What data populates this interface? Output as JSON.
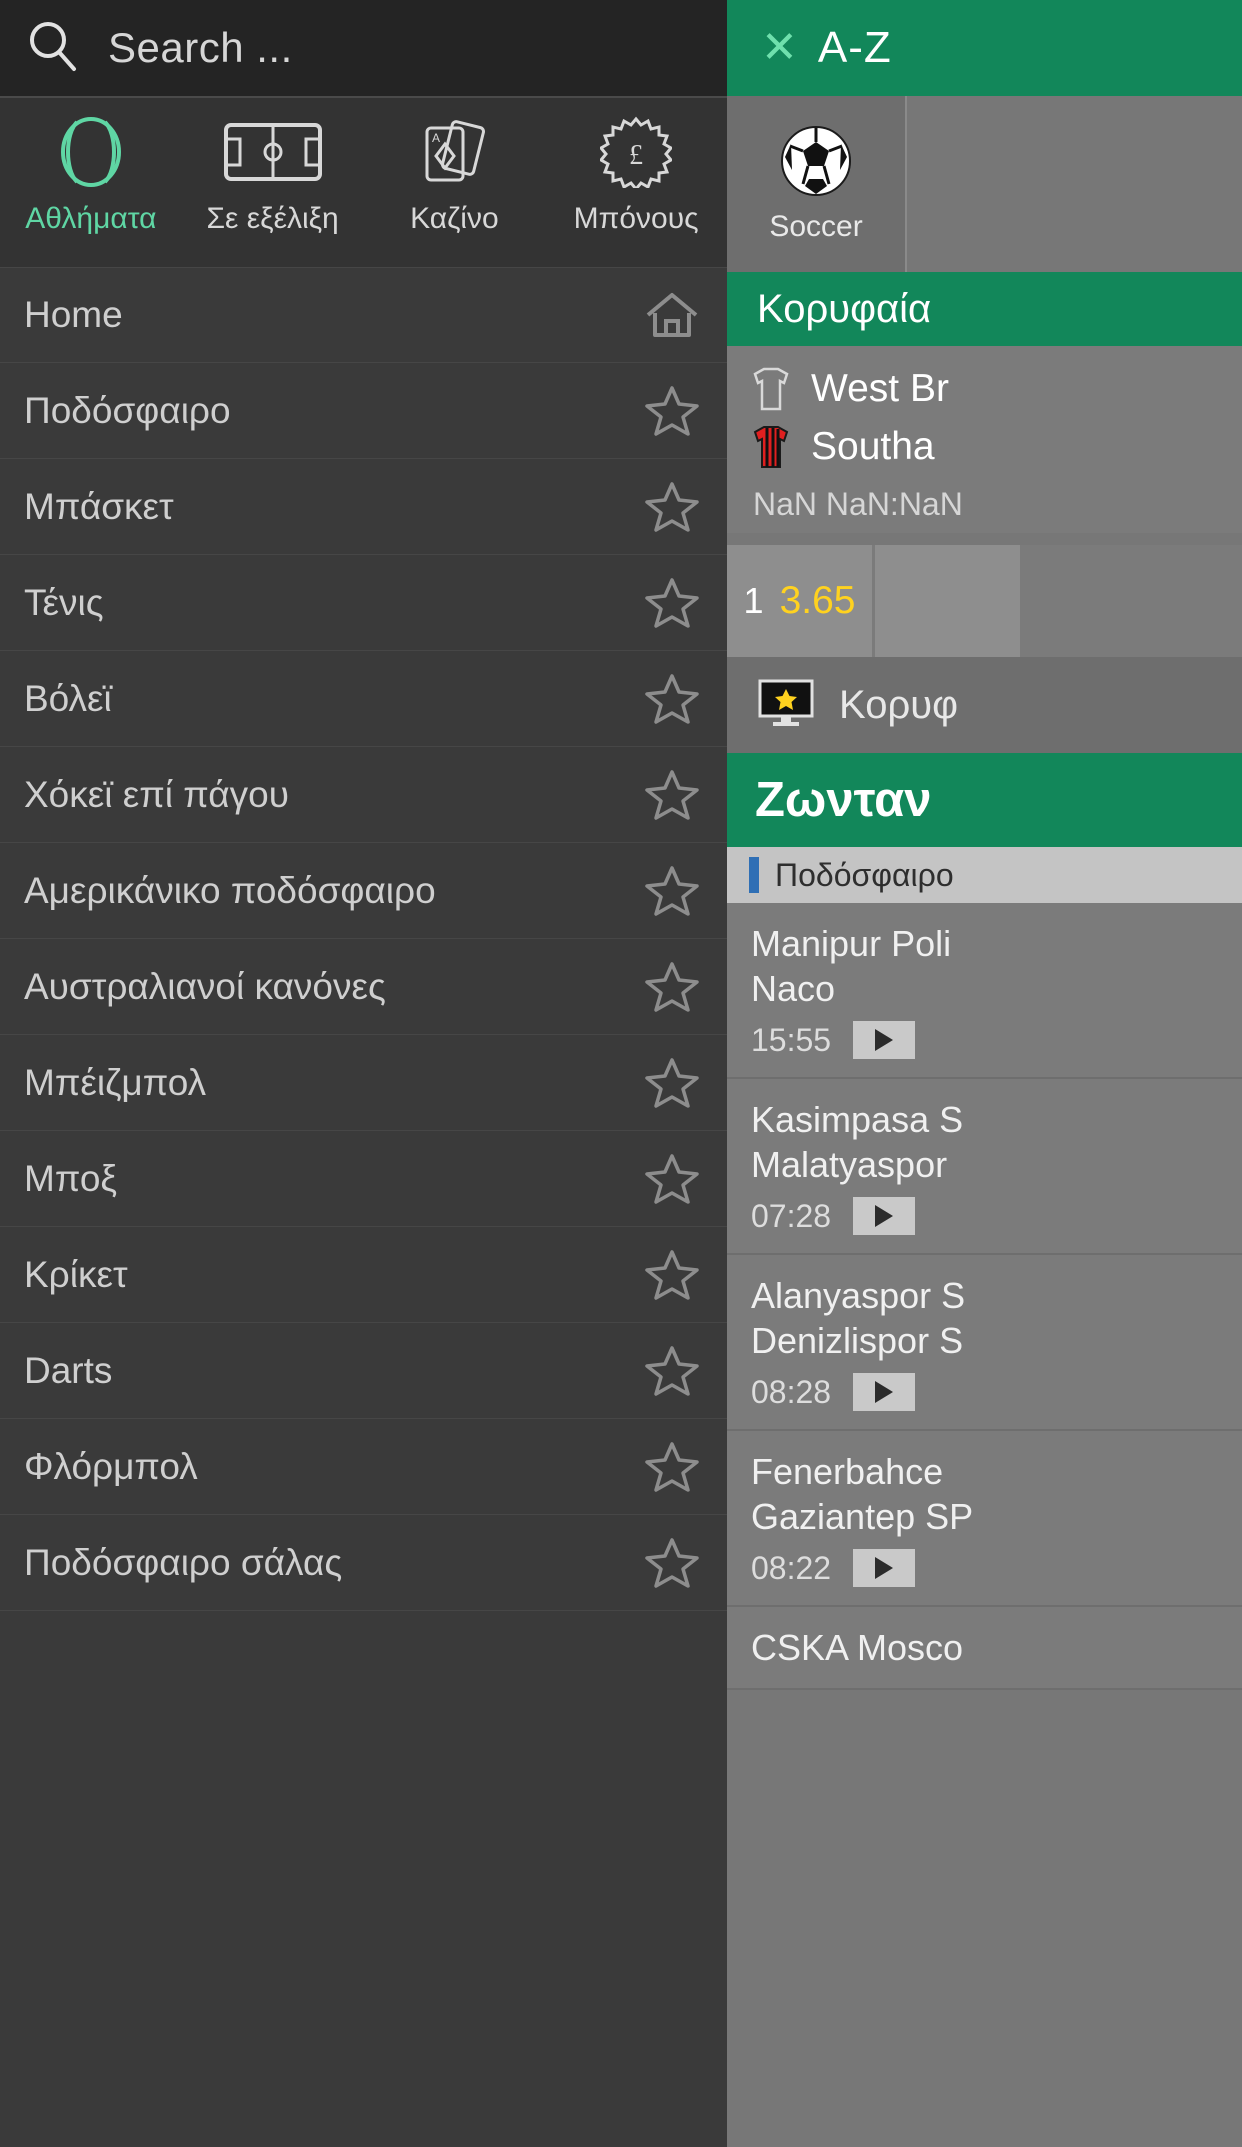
{
  "search": {
    "placeholder": "Search ...",
    "icon": "search-icon"
  },
  "tabs": [
    {
      "label": "Αθλήματα",
      "icon": "tennis-ball-icon",
      "active": true
    },
    {
      "label": "Σε εξέλιξη",
      "icon": "soccer-pitch-icon",
      "active": false
    },
    {
      "label": "Καζίνο",
      "icon": "playing-cards-icon",
      "active": false
    },
    {
      "label": "Μπόνους",
      "icon": "pound-badge-icon",
      "active": false
    }
  ],
  "sidebar": {
    "items": [
      {
        "label": "Home",
        "icon": "home-icon"
      },
      {
        "label": "Ποδόσφαιρο",
        "icon": "star-icon"
      },
      {
        "label": "Μπάσκετ",
        "icon": "star-icon"
      },
      {
        "label": "Τένις",
        "icon": "star-icon"
      },
      {
        "label": "Βόλεϊ",
        "icon": "star-icon"
      },
      {
        "label": "Χόκεϊ επί πάγου",
        "icon": "star-icon"
      },
      {
        "label": "Αμερικάνικο ποδόσφαιρο",
        "icon": "star-icon"
      },
      {
        "label": "Αυστραλιανοί κανόνες",
        "icon": "star-icon"
      },
      {
        "label": "Μπέιζμπολ",
        "icon": "star-icon"
      },
      {
        "label": "Μποξ",
        "icon": "star-icon"
      },
      {
        "label": "Κρίκετ",
        "icon": "star-icon"
      },
      {
        "label": "Darts",
        "icon": "star-icon"
      },
      {
        "label": "Φλόρμπολ",
        "icon": "star-icon"
      },
      {
        "label": "Ποδόσφαιρο σάλας",
        "icon": "star-icon"
      }
    ]
  },
  "right": {
    "az": {
      "close": "✕",
      "label": "A-Z"
    },
    "sport_chip": {
      "label": "Soccer",
      "icon": "soccer-ball-icon"
    },
    "top_header": "Κορυφαία ",
    "featured_match": {
      "home": "West Br",
      "away": "Southa",
      "time": "NaN NaN:NaN",
      "odds": [
        {
          "key": "1",
          "value": "3.65"
        },
        {
          "key": "",
          "value": ""
        }
      ]
    },
    "top_events_row": {
      "label": "Κορυφ",
      "icon": "tv-star-icon"
    },
    "live_header": "Ζωνταν",
    "live_category": {
      "label": "Ποδόσφαιρο",
      "icon": "category-bar-icon"
    },
    "live_matches": [
      {
        "home": "Manipur Poli",
        "away": "Naco",
        "time": "15:55",
        "play": "play-icon"
      },
      {
        "home": "Kasimpasa S",
        "away": "Malatyaspor",
        "time": "07:28",
        "play": "play-icon"
      },
      {
        "home": "Alanyaspor S",
        "away": "Denizlispor S",
        "time": "08:28",
        "play": "play-icon"
      },
      {
        "home": "Fenerbahce ",
        "away": "Gaziantep SP",
        "time": "08:22",
        "play": "play-icon"
      },
      {
        "home": "CSKA Mosco",
        "away": "",
        "time": "",
        "play": "play-icon"
      }
    ]
  },
  "colors": {
    "brand_green": "#12875a",
    "accent_mint": "#5fd6a4",
    "odds_yellow": "#ffd21f",
    "panel_dark": "#3a3a3a",
    "panel_light": "#7b7b7b"
  }
}
